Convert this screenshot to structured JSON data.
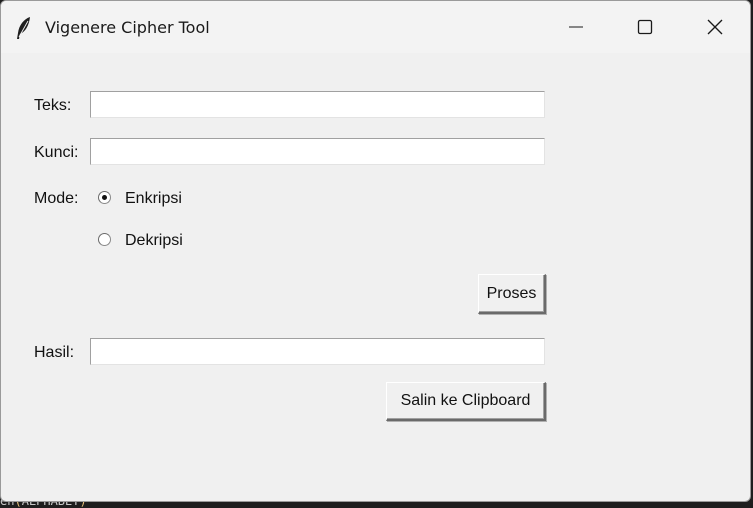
{
  "window": {
    "title": "Vigenere Cipher Tool",
    "icons": {
      "app": "feather-icon",
      "minimize": "minimize-icon",
      "maximize": "maximize-icon",
      "close": "close-icon"
    }
  },
  "form": {
    "text_label": "Teks:",
    "text_value": "",
    "key_label": "Kunci:",
    "key_value": "",
    "mode_label": "Mode:",
    "mode_options": [
      "Enkripsi",
      "Dekripsi"
    ],
    "mode_selected": "Enkripsi",
    "process_button": "Proses",
    "result_label": "Hasil:",
    "result_value": "",
    "copy_button": "Salin ke Clipboard"
  },
  "background": {
    "code_fragment_prefix": "en",
    "code_fragment_paren_open": "(",
    "code_fragment_arg": "ALPHABET",
    "code_fragment_paren_close": ")"
  }
}
